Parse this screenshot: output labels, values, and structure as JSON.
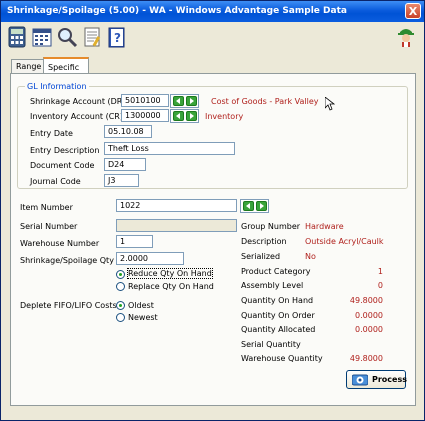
{
  "window": {
    "title": "Shrinkage/Spoilage (5.00) - WA - Windows Advantage Sample Data",
    "close": "X"
  },
  "toolbar": {
    "icons": [
      "calculator-icon",
      "calendar-icon",
      "search-icon",
      "notes-icon",
      "help-icon",
      "mascot-icon"
    ]
  },
  "tabs": [
    {
      "label": "Range"
    },
    {
      "label": "Specific"
    }
  ],
  "gl": {
    "heading": "GL Information",
    "shrinkage_label": "Shrinkage Account (DR)",
    "shrinkage_value": "5010100",
    "shrinkage_desc": "Cost of Goods - Park Valley",
    "inventory_label": "Inventory Account (CR)",
    "inventory_value": "1300000",
    "inventory_desc": "Inventory",
    "entry_date_label": "Entry Date",
    "entry_date_value": "05.10.08",
    "entry_desc_label": "Entry Description",
    "entry_desc_value": "Theft Loss",
    "doc_code_label": "Document Code",
    "doc_code_value": "D24",
    "journal_label": "Journal Code",
    "journal_value": "J3"
  },
  "item": {
    "item_number_label": "Item Number",
    "item_number_value": "1022",
    "serial_label": "Serial Number",
    "serial_value": "",
    "warehouse_label": "Warehouse Number",
    "warehouse_value": "1",
    "qty_label": "Shrinkage/Spoilage Qty",
    "qty_value": "2.0000",
    "reduce_label": "Reduce Qty On Hand",
    "replace_label": "Replace Qty On Hand",
    "deplete_label": "Deplete FIFO/LIFO Costs",
    "oldest_label": "Oldest",
    "newest_label": "Newest"
  },
  "info": {
    "group_label": "Group Number",
    "group_value": "Hardware",
    "desc_label": "Description",
    "desc_value": "Outside Acryl/Caulk",
    "serialized_label": "Serialized",
    "serialized_value": "No",
    "category_label": "Product Category",
    "category_value": "1",
    "assembly_label": "Assembly Level",
    "assembly_value": "0",
    "qoh_label": "Quantity On Hand",
    "qoh_value": "49.8000",
    "qoo_label": "Quantity On Order",
    "qoo_value": "0.0000",
    "qa_label": "Quantity Allocated",
    "qa_value": "0.0000",
    "sq_label": "Serial Quantity",
    "wq_label": "Warehouse Quantity",
    "wq_value": "49.8000"
  },
  "process_button": "Process",
  "colors": {
    "title_bar": "#0a5bdc",
    "accent_red": "#b0211d",
    "link_blue": "#0046d5",
    "nav_green": "#39a33a"
  }
}
